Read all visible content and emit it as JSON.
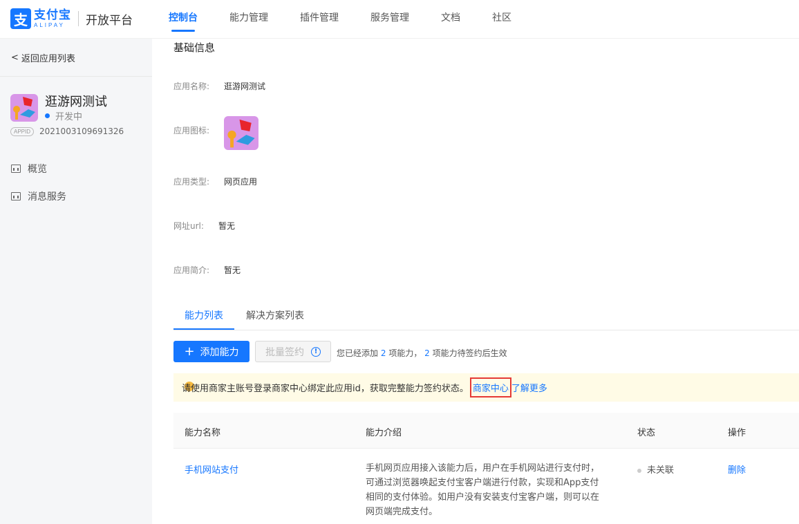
{
  "brand": {
    "cn": "支付宝",
    "en": "ALIPAY",
    "platform": "开放平台",
    "mark": "支"
  },
  "nav": [
    {
      "label": "控制台",
      "active": true
    },
    {
      "label": "能力管理"
    },
    {
      "label": "插件管理"
    },
    {
      "label": "服务管理"
    },
    {
      "label": "文档"
    },
    {
      "label": "社区"
    }
  ],
  "sidebar": {
    "back_label": "返回应用列表",
    "app_name": "逛游网测试",
    "status": "开发中",
    "appid_badge": "APPID",
    "appid": "2021003109691326",
    "menu": [
      {
        "label": "概览"
      },
      {
        "label": "消息服务"
      }
    ]
  },
  "basic": {
    "title": "基础信息",
    "fields": [
      {
        "label": "应用名称:",
        "value": "逛游网测试"
      },
      {
        "label": "应用图标:",
        "value": ""
      },
      {
        "label": "应用类型:",
        "value": "网页应用"
      },
      {
        "label": "网址url:",
        "value": "暂无"
      },
      {
        "label": "应用简介:",
        "value": "暂无"
      }
    ]
  },
  "tabs": [
    {
      "label": "能力列表",
      "active": true
    },
    {
      "label": "解决方案列表"
    }
  ],
  "actions": {
    "add_label": "添加能力",
    "batch_label": "批量签约",
    "info_glyph": "!",
    "summary_pre": "您已经添加",
    "summary_count1": "2",
    "summary_mid": "项能力，",
    "summary_count2": "2",
    "summary_post": "项能力待签约后生效"
  },
  "notice": {
    "text": "请使用商家主账号登录商家中心绑定此应用id，获取完整能力签约状态。",
    "link1": "商家中心",
    "link2": "了解更多"
  },
  "table": {
    "headers": [
      "能力名称",
      "能力介绍",
      "状态",
      "操作"
    ],
    "rows": [
      {
        "name": "手机网站支付",
        "desc": "手机网页应用接入该能力后，用户在手机网站进行支付时，可通过浏览器唤起支付宝客户端进行付款，实现和App支付相同的支付体验。如用户没有安装支付宝客户端，则可以在网页端完成支付。",
        "status": "未关联",
        "action": "删除"
      }
    ]
  },
  "colors": {
    "accent": "#1677ff",
    "notice_bg": "#fffbe6",
    "highlight_border": "#e53935"
  }
}
